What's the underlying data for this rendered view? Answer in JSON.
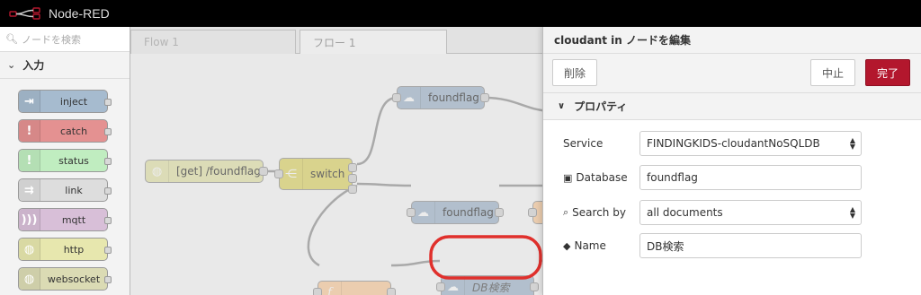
{
  "app": {
    "title": "Node-RED"
  },
  "palette": {
    "search_placeholder": "ノードを検索",
    "category": "入力",
    "nodes": [
      {
        "label": "inject",
        "color": "#a6bbcf"
      },
      {
        "label": "catch",
        "color": "#e49191"
      },
      {
        "label": "status",
        "color": "#c0edc0"
      },
      {
        "label": "link",
        "color": "#dddddd"
      },
      {
        "label": "mqtt",
        "color": "#d8bfd8"
      },
      {
        "label": "http",
        "color": "#e7e7ae"
      },
      {
        "label": "websocket",
        "color": "#dbdbb4"
      }
    ]
  },
  "workspace": {
    "tabs": [
      {
        "label": "Flow 1",
        "active": false
      },
      {
        "label": "フロー 1",
        "active": true
      }
    ],
    "nodes": {
      "http_in": {
        "label": "[get] /foundflag",
        "color": "#e7e7ae"
      },
      "switch": {
        "label": "switch",
        "color": "#e2d96e"
      },
      "foundflag_1": {
        "label": "foundflag",
        "color": "#a6bbcf"
      },
      "foundflag_2": {
        "label": "foundflag",
        "color": "#a6bbcf"
      },
      "function": {
        "label": "",
        "color": "#fdd0a2"
      },
      "db_search": {
        "label": "DB検索",
        "color": "#a6bbcf"
      }
    },
    "highlight_color": "#e0302c"
  },
  "tray": {
    "title": "cloudant in ノードを編集",
    "delete_label": "削除",
    "cancel_label": "中止",
    "done_label": "完了",
    "section_label": "プロパティ",
    "fields": {
      "service_label": "Service",
      "service_value": "FINDINGKIDS-cloudantNoSQLDB",
      "database_label": "Database",
      "database_value": "foundflag",
      "search_label": "Search by",
      "search_value": "all documents",
      "name_label": "Name",
      "name_value": "DB検索"
    }
  }
}
